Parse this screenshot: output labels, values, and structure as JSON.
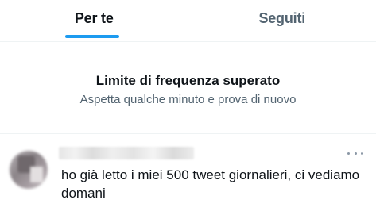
{
  "tabs": {
    "for_you": "Per te",
    "following": "Seguiti",
    "active_tab": "Per te"
  },
  "notice": {
    "title": "Limite di frequenza superato",
    "subtitle": "Aspetta qualche minuto e prova di nuovo"
  },
  "tweet": {
    "author_name_blurred": true,
    "avatar_blurred": true,
    "text": "ho già letto i miei 500 tweet giornalieri, ci vediamo domani",
    "more_icon": "more-horizontal-icon"
  },
  "colors": {
    "accent": "#1d9bf0",
    "text_primary": "#0f1419",
    "text_secondary": "#536471",
    "divider": "#eff3f4"
  }
}
